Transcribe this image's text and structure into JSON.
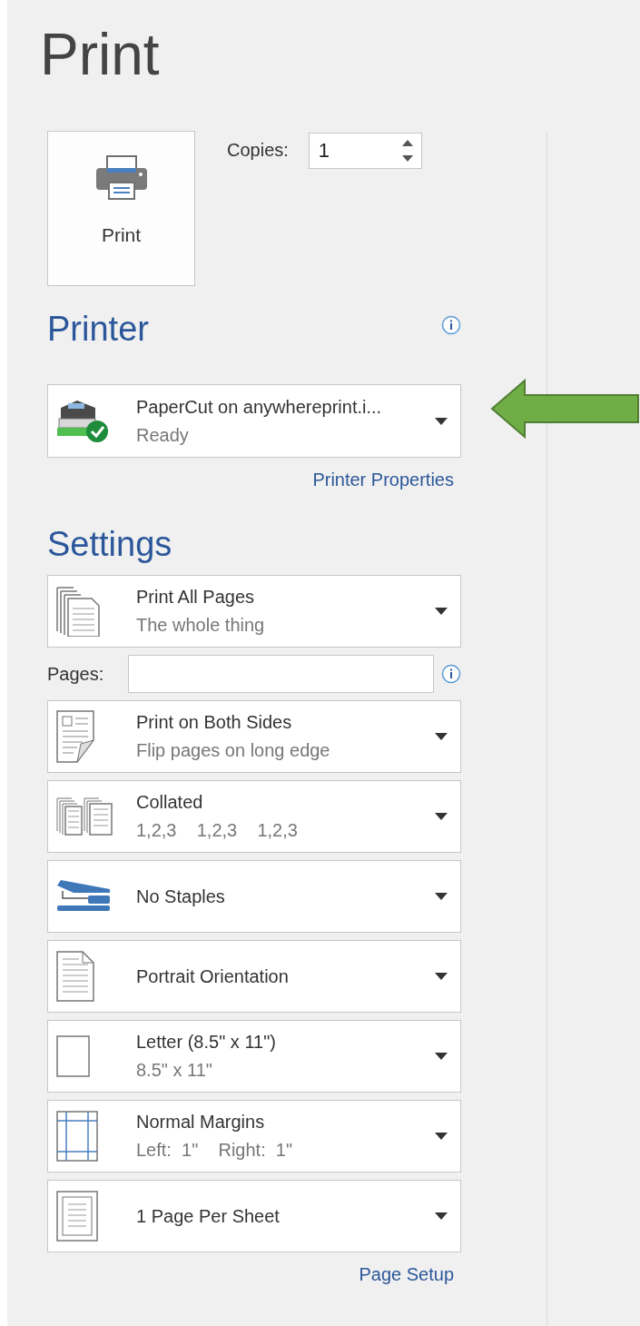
{
  "title": "Print",
  "print_button": {
    "label": "Print"
  },
  "copies": {
    "label": "Copies:",
    "value": "1"
  },
  "printer": {
    "heading": "Printer",
    "name": "PaperCut on anywhereprint.i...",
    "status": "Ready",
    "link": "Printer Properties"
  },
  "settings": {
    "heading": "Settings",
    "items": [
      {
        "kind": "pages",
        "title": "Print All Pages",
        "subtitle": "The whole thing"
      },
      {
        "kind": "range",
        "label": "Pages:"
      },
      {
        "kind": "sides",
        "title": "Print on Both Sides",
        "subtitle": "Flip pages on long edge"
      },
      {
        "kind": "collate",
        "title": "Collated",
        "subtitle": "1,2,3    1,2,3    1,2,3"
      },
      {
        "kind": "staples",
        "title": "No Staples"
      },
      {
        "kind": "orientation",
        "title": "Portrait Orientation"
      },
      {
        "kind": "paper",
        "title": "Letter (8.5\" x 11\")",
        "subtitle": "8.5\" x 11\""
      },
      {
        "kind": "margins",
        "title": "Normal Margins",
        "subtitle": "Left:  1\"    Right:  1\""
      },
      {
        "kind": "persheet",
        "title": "1 Page Per Sheet"
      }
    ],
    "link": "Page Setup"
  }
}
